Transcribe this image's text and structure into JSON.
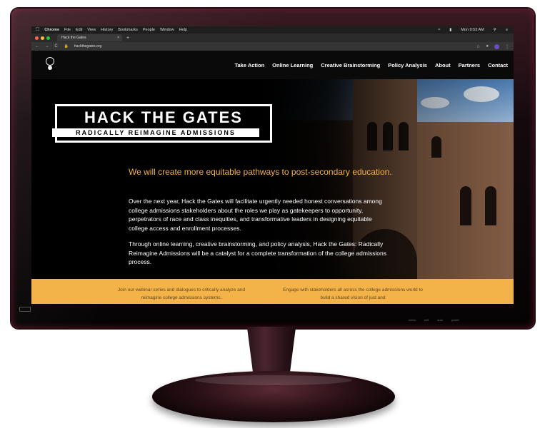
{
  "browser": {
    "menubar": {
      "apple": "",
      "items": [
        "Chrome",
        "File",
        "Edit",
        "View",
        "History",
        "Bookmarks",
        "People",
        "Window",
        "Help"
      ],
      "clock": "Mon 9:53 AM"
    },
    "tab": {
      "title": "Hack the Gates",
      "close": "×",
      "new_tab": "+"
    },
    "address": {
      "nav": "← → C",
      "url": "hackthegates.org"
    },
    "traffic_lights": [
      "#ff5f57",
      "#febc2e",
      "#28c840"
    ]
  },
  "site": {
    "nav": {
      "links": [
        "Take Action",
        "Online Learning",
        "Creative Brainstorming",
        "Policy Analysis",
        "About",
        "Partners",
        "Contact"
      ]
    },
    "hero": {
      "logo_title": "HACK THE GATES",
      "logo_subtitle": "RADICALLY REIMAGINE ADMISSIONS",
      "tagline": "We will create more equitable pathways to post-secondary education.",
      "paragraph1": "Over the next year, Hack the Gates will facilitate urgently needed honest conversations among college admissions stakeholders about the roles we play as gatekeepers to opportunity, perpetrators of race and class inequities, and transformative leaders in designing equitable college access and enrollment processes.",
      "paragraph2": "Through online learning, creative brainstorming, and policy analysis, Hack the Gates: Radically Reimagine Admissions will be a catalyst for a complete transformation of the college admissions process."
    },
    "features": {
      "col1": "Join our webinar series and dialogues to critically analyze and reimagine college admissions systems.",
      "col2": "Engage with stakeholders all across the college admissions world to build a shared vision of just and"
    },
    "colors": {
      "accent": "#f5b13d",
      "strip": "#f4b348"
    }
  },
  "monitor": {
    "controls": [
      "menu",
      "exit",
      "auto",
      "power",
      "",
      ""
    ]
  }
}
